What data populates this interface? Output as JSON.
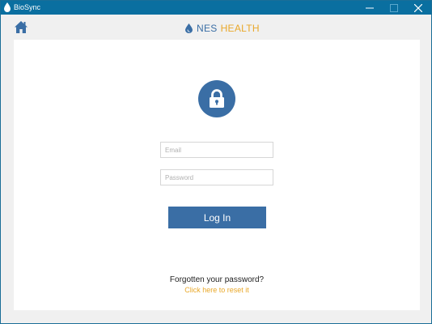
{
  "window": {
    "title": "BioSync",
    "controls": {
      "minimize": "minimize-icon",
      "maximize": "maximize-icon",
      "close": "close-icon"
    }
  },
  "header": {
    "home_icon": "home-icon",
    "brand": {
      "logo_icon": "water-drop-icon",
      "name_primary": "NES",
      "name_secondary": "HEALTH"
    }
  },
  "login": {
    "lock_icon": "lock-icon",
    "email": {
      "placeholder": "Email",
      "value": ""
    },
    "password": {
      "placeholder": "Password",
      "value": ""
    },
    "submit_label": "Log In",
    "forgot_text": "Forgotten your password?",
    "reset_link": "Click here to reset it"
  },
  "colors": {
    "titlebar": "#0a6fa0",
    "primary": "#3a6ea5",
    "accent": "#e9a82a",
    "background": "#f0f0f0",
    "panel": "#ffffff"
  }
}
